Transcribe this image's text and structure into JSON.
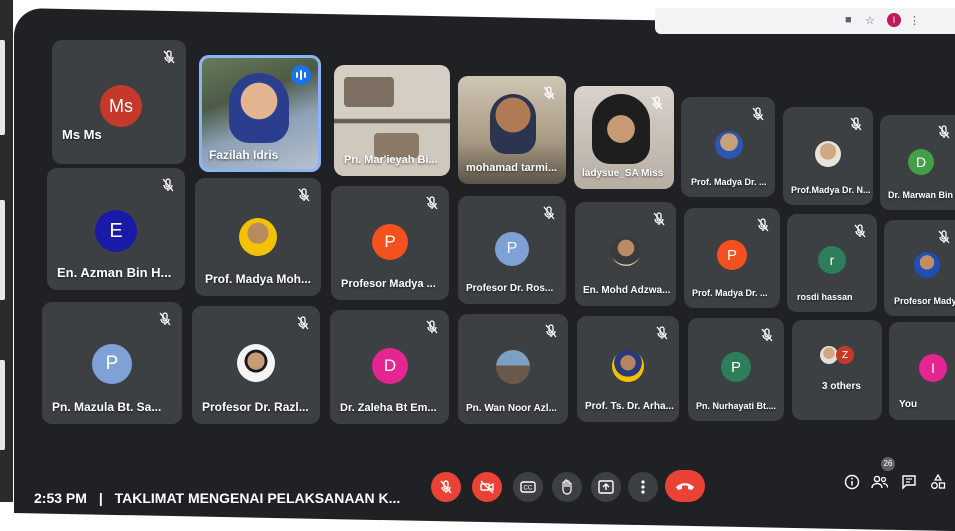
{
  "browser": {
    "profile_initial": "I"
  },
  "meeting": {
    "time": "2:53 PM",
    "separator": "|",
    "title": "TAKLIMAT MENGENAI PELAKSANAAN K...",
    "participant_count": "26"
  },
  "participants": [
    {
      "name": "Ms Ms",
      "initial": "Ms",
      "color": "#c5392b",
      "muted": true,
      "kind": "avatar"
    },
    {
      "name": "Fazilah Idris",
      "muted": false,
      "kind": "video",
      "speaking": true
    },
    {
      "name": "Pn. Mar'ieyah Bi...",
      "muted": false,
      "kind": "video"
    },
    {
      "name": "mohamad tarmi...",
      "muted": true,
      "kind": "video"
    },
    {
      "name": "ladysue_SA Miss",
      "muted": true,
      "kind": "video"
    },
    {
      "name": "Prof. Madya Dr. ...",
      "muted": true,
      "kind": "photo"
    },
    {
      "name": "Prof.Madya Dr. N...",
      "muted": true,
      "kind": "photo"
    },
    {
      "name": "Dr. Marwan Bin I...",
      "initial": "D",
      "color": "#43a047",
      "muted": true,
      "kind": "avatar"
    },
    {
      "name": "En. Azman Bin H...",
      "initial": "E",
      "color": "#1a1aa8",
      "muted": true,
      "kind": "avatar"
    },
    {
      "name": "Prof. Madya Moh...",
      "muted": true,
      "kind": "photo"
    },
    {
      "name": "Profesor Madya ...",
      "initial": "P",
      "color": "#f4511e",
      "muted": true,
      "kind": "avatar"
    },
    {
      "name": "Profesor Dr. Ros...",
      "initial": "P",
      "color": "#7fa1d6",
      "muted": true,
      "kind": "avatar"
    },
    {
      "name": "En. Mohd Adzwa...",
      "muted": true,
      "kind": "photo"
    },
    {
      "name": "Prof. Madya Dr. ...",
      "initial": "P",
      "color": "#f4511e",
      "muted": true,
      "kind": "avatar"
    },
    {
      "name": "rosdi hassan",
      "initial": "r",
      "color": "#2e7d5b",
      "muted": true,
      "kind": "avatar"
    },
    {
      "name": "Profesor Madya",
      "muted": true,
      "kind": "photo"
    },
    {
      "name": "Pn. Mazula Bt. Sa...",
      "initial": "P",
      "color": "#7fa1d6",
      "muted": true,
      "kind": "avatar"
    },
    {
      "name": "Profesor Dr. Razl...",
      "muted": true,
      "kind": "photo"
    },
    {
      "name": "Dr. Zaleha Bt Em...",
      "initial": "D",
      "color": "#e52592",
      "muted": true,
      "kind": "avatar"
    },
    {
      "name": "Pn. Wan Noor Azl...",
      "muted": true,
      "kind": "photo"
    },
    {
      "name": "Prof. Ts. Dr. Arha...",
      "muted": true,
      "kind": "photo"
    },
    {
      "name": "Pn. Nurhayati Bt....",
      "initial": "P",
      "color": "#2e7d5b",
      "muted": true,
      "kind": "avatar"
    },
    {
      "name": "3 others",
      "initial": "Z",
      "color": "#c5392b",
      "muted": true,
      "kind": "others"
    },
    {
      "name": "You",
      "initial": "I",
      "color": "#e52592",
      "muted": false,
      "kind": "avatar"
    }
  ],
  "controls": [
    {
      "id": "mic",
      "icon": "mic-off-icon",
      "color": "#ea4335"
    },
    {
      "id": "camera",
      "icon": "camera-off-icon",
      "color": "#ea4335"
    },
    {
      "id": "captions",
      "icon": "captions-icon",
      "color": "#3c4043"
    },
    {
      "id": "raise-hand",
      "icon": "hand-icon",
      "color": "#3c4043"
    },
    {
      "id": "present",
      "icon": "present-icon",
      "color": "#3c4043"
    },
    {
      "id": "more",
      "icon": "more-vert-icon",
      "color": "#3c4043"
    },
    {
      "id": "leave",
      "icon": "phone-hangup-icon",
      "color": "#ea4335"
    }
  ],
  "side_controls": [
    "info-icon",
    "people-icon",
    "chat-icon",
    "activities-icon"
  ]
}
